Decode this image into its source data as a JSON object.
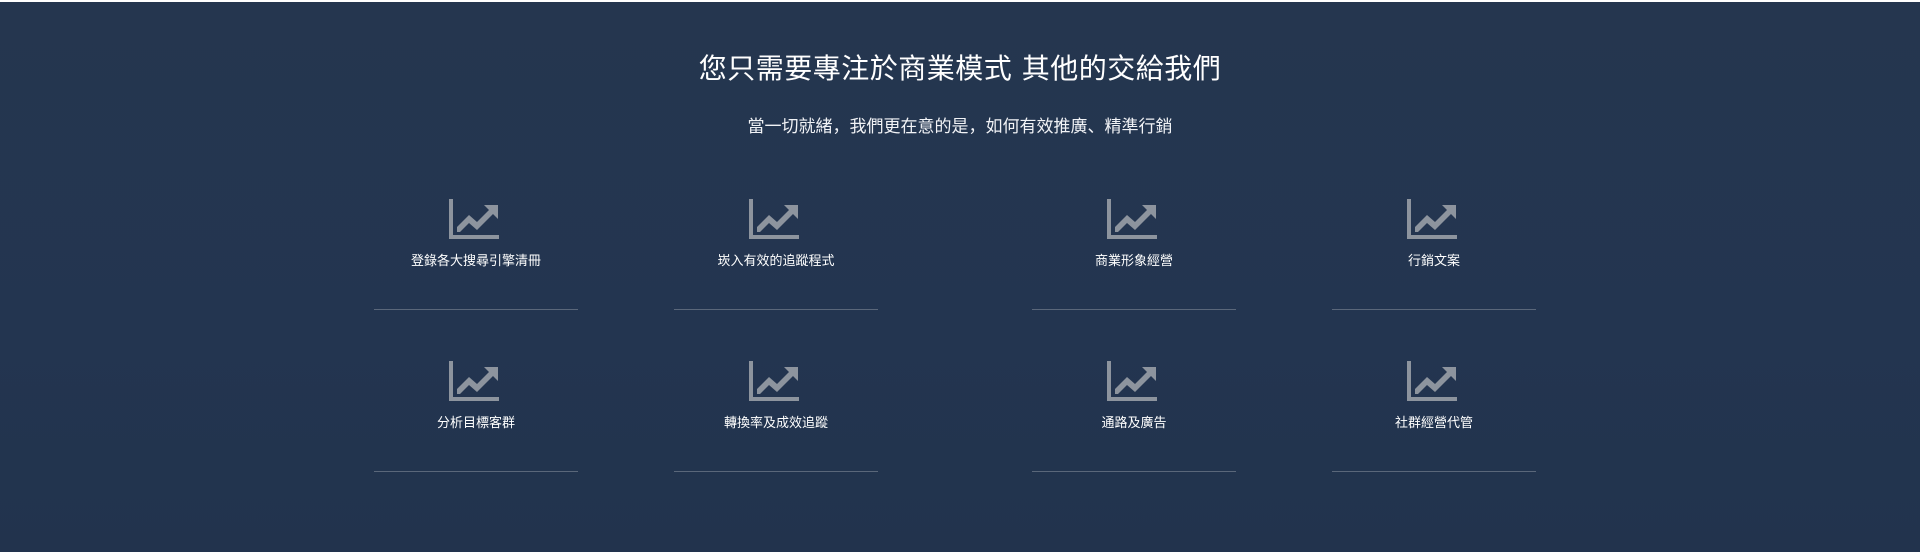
{
  "section": {
    "title": "您只需要專注於商業模式 其他的交給我們",
    "subtitle": "當一切就緒，我們更在意的是，如何有效推廣、精準行銷"
  },
  "features": [
    {
      "label": "登錄各大搜尋引擎清冊",
      "icon": "area-chart-icon"
    },
    {
      "label": "崁入有效的追蹤程式",
      "icon": "area-chart-icon"
    },
    {
      "label": "商業形象經營",
      "icon": "area-chart-icon"
    },
    {
      "label": "行銷文案",
      "icon": "area-chart-icon"
    },
    {
      "label": "分析目標客群",
      "icon": "area-chart-icon"
    },
    {
      "label": "轉換率及成效追蹤",
      "icon": "area-chart-icon"
    },
    {
      "label": "通路及廣告",
      "icon": "area-chart-icon"
    },
    {
      "label": "社群經營代管",
      "icon": "area-chart-icon"
    }
  ],
  "colors": {
    "background": "#24354f",
    "icon": "#8d949e",
    "divider": "#5a677a",
    "text": "#ffffff"
  }
}
